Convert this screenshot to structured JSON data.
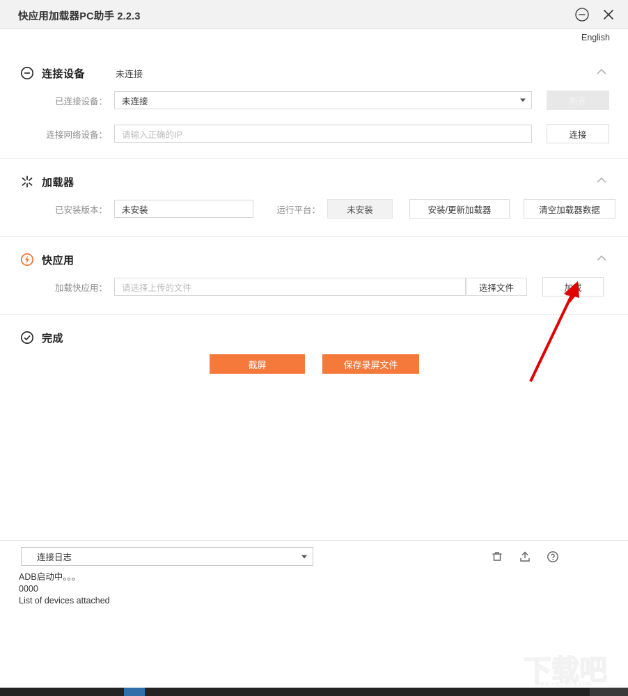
{
  "window": {
    "title": "快应用加载器PC助手 2.2.3",
    "minimize_icon": "circle-minus-icon",
    "close_icon": "close-icon",
    "language_link": "English"
  },
  "sections": {
    "connect_device": {
      "icon": "circle-minus-icon",
      "title": "连接设备",
      "status": "未连接",
      "collapse_icon": "chevron-up-icon",
      "connected_device_label": "已连接设备：",
      "connected_device_value": "未连接",
      "disconnect_button": "断开",
      "network_device_label": "连接网络设备：",
      "network_device_placeholder": "请输入正确的IP",
      "connect_button": "连接"
    },
    "loader": {
      "icon": "spark-icon",
      "title": "加载器",
      "collapse_icon": "chevron-up-icon",
      "installed_version_label": "已安装版本：",
      "installed_version_value": "未安装",
      "platform_label": "运行平台：",
      "platform_value": "未安装",
      "install_update_button": "安装/更新加载器",
      "clear_data_button": "清空加载器数据"
    },
    "quickapp": {
      "icon": "quickapp-bolt-icon",
      "title": "快应用",
      "collapse_icon": "chevron-up-icon",
      "load_label": "加载快应用：",
      "load_placeholder": "请选择上传的文件",
      "choose_file_button": "选择文件",
      "load_button": "加载"
    },
    "finish": {
      "icon": "check-circle-icon",
      "title": "完成",
      "screenshot_button": "截屏",
      "save_recording_button": "保存录屏文件"
    }
  },
  "log": {
    "selected_option": "连接日志",
    "caret_icon": "chevron-down-icon",
    "clear_icon": "trash-icon",
    "export_icon": "upload-icon",
    "help_icon": "help-circle-icon",
    "lines": [
      "ADB启动中。。。",
      "0000",
      "List of devices attached"
    ]
  },
  "watermark": {
    "text": "下载吧",
    "url": "www.xiazaiba.com"
  },
  "colors": {
    "accent_orange": "#f5793b",
    "titlebar_bg": "#f2f2f2",
    "annotation_red": "#e00000"
  }
}
